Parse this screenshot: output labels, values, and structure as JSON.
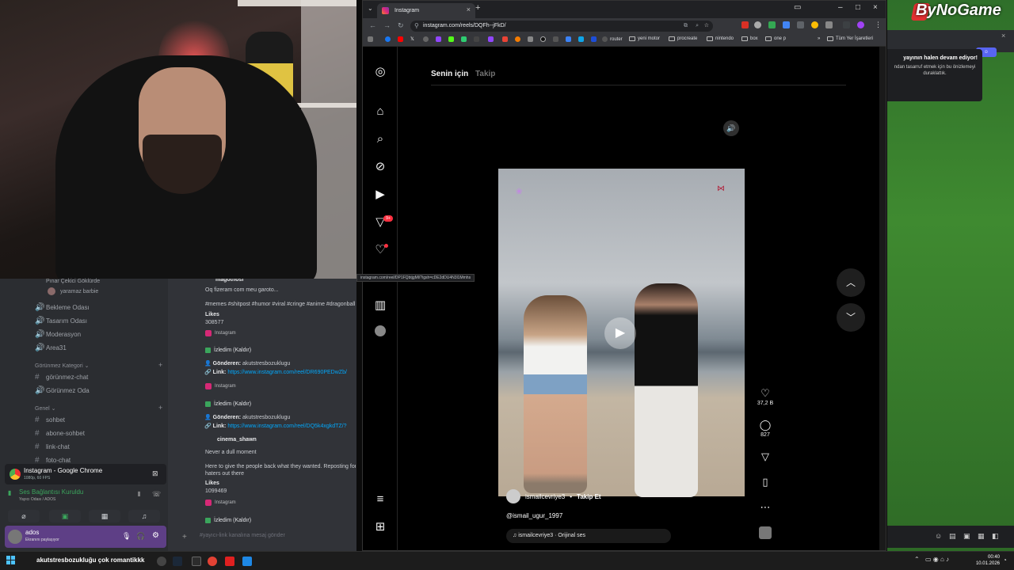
{
  "discord": {
    "channels": [
      {
        "label": "Bekleme Odası"
      },
      {
        "label": "Tasarım Odası"
      },
      {
        "label": "Moderasyon"
      },
      {
        "label": "Area31"
      }
    ],
    "voice_user": "yaramaz barbie",
    "top_user": "Pınar Çekici Göklürde",
    "category_hidden": "Görünmez Kategori",
    "hidden_channels": [
      "görünmez-chat",
      "Görünmez Oda"
    ],
    "category_general": "Genel",
    "general_channels": [
      "sohbet",
      "abone-sohbet",
      "link-chat",
      "foto-chat"
    ],
    "stream_title": "Instagram - Google Chrome",
    "stream_sub": "1080p, 60 FPS",
    "voice_connected": "Ses Bağlantısı Kuruldu",
    "voice_room": "Yayıcı Odası / ADOS",
    "username": "ados",
    "user_status": "Ekranını paylaşıyor",
    "input_placeholder": "#yayıcı-link kanalına mesaj gönder",
    "chat": {
      "first_author": "magotnosi",
      "line1": "Oq fizeram com meu garoto...",
      "hashtags": "#memes #shitpost #humor #viral #cringe #anime #dragonball",
      "likes_label": "Likes",
      "likes1": "308577",
      "ig_label": "Instagram",
      "watched": "İzledim (Kaldır)",
      "sent_label": "Gönderen:",
      "sender": "akutstresbozuklugu",
      "link_label": "Link:",
      "link1": "https://www.instagram.com/reel/DR690PEDwZb/",
      "link2": "https://www.instagram.com/reel/DQ5k4xgkdTZ/?",
      "author2": "cinema_shawn",
      "line2": "Never a dull moment",
      "line3": "Here to give the people back what they wanted. Reposting for all the",
      "line4": "haters out there",
      "likes2": "1099469"
    }
  },
  "chrome": {
    "tab_title": "Instagram",
    "url": "instagram.com/reels/DQFh--jFkD/",
    "bookmarks": [
      "router",
      "yeni motor",
      "procreate",
      "nintendo",
      "box",
      "one p"
    ],
    "all_bookmarks": "Tüm Yer İşaretleri",
    "hover_url": "instagram.com/reel/DP1FQbtjgMl/?igsh=cDE2dDU4N3l1Mmhs"
  },
  "instagram": {
    "tab_for_you": "Senin için",
    "tab_following": "Takip",
    "notif_badge": "9+",
    "reel": {
      "author": "ismailcevriye3",
      "separator": "•",
      "follow": "Takip Et",
      "caption": "@ismail_ugur_1997",
      "audio": "ismailcevriye3 · Orijinal ses"
    },
    "likes": "37,2 B",
    "comments": "827"
  },
  "right_panel": {
    "brand": "ByNoGame",
    "notif_title": "yayının halen devam ediyor!",
    "notif_desc": "ndan tasarruf etmek için bu önizlemeyi duraklattık."
  },
  "taskbar": {
    "task_text": "akutstresbozukluğu çok romantikkk",
    "time": "00:40",
    "date": "10.01.2026"
  },
  "colors": {
    "discord_bg": "#2b2d31",
    "chat_bg": "#313338",
    "link": "#00a8fc",
    "ig_badge": "#ff3040",
    "brand_green": "#3f8a30"
  }
}
